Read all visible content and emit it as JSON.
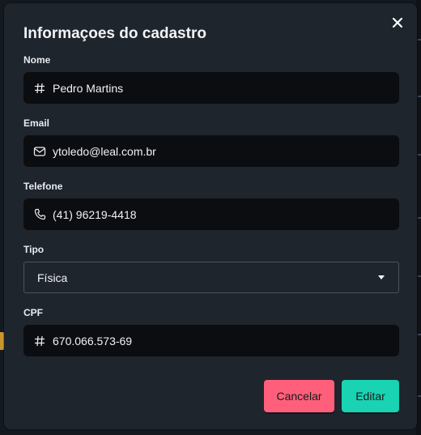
{
  "modal": {
    "title": "Informaçoes do cadastro"
  },
  "fields": {
    "nome": {
      "label": "Nome",
      "value": "Pedro Martins",
      "icon": "hash-icon"
    },
    "email": {
      "label": "Email",
      "value": "ytoledo@leal.com.br",
      "icon": "mail-icon"
    },
    "telefone": {
      "label": "Telefone",
      "value": "(41) 96219-4418",
      "icon": "phone-icon"
    },
    "tipo": {
      "label": "Tipo",
      "value": "Física"
    },
    "cpf": {
      "label": "CPF",
      "value": "670.066.573-69",
      "icon": "hash-icon"
    }
  },
  "actions": {
    "cancel_label": "Cancelar",
    "edit_label": "Editar"
  },
  "colors": {
    "cancel": "#ff5f7a",
    "edit": "#19d3b3",
    "modal_bg": "#1f252d",
    "input_bg": "#0b0d10"
  }
}
